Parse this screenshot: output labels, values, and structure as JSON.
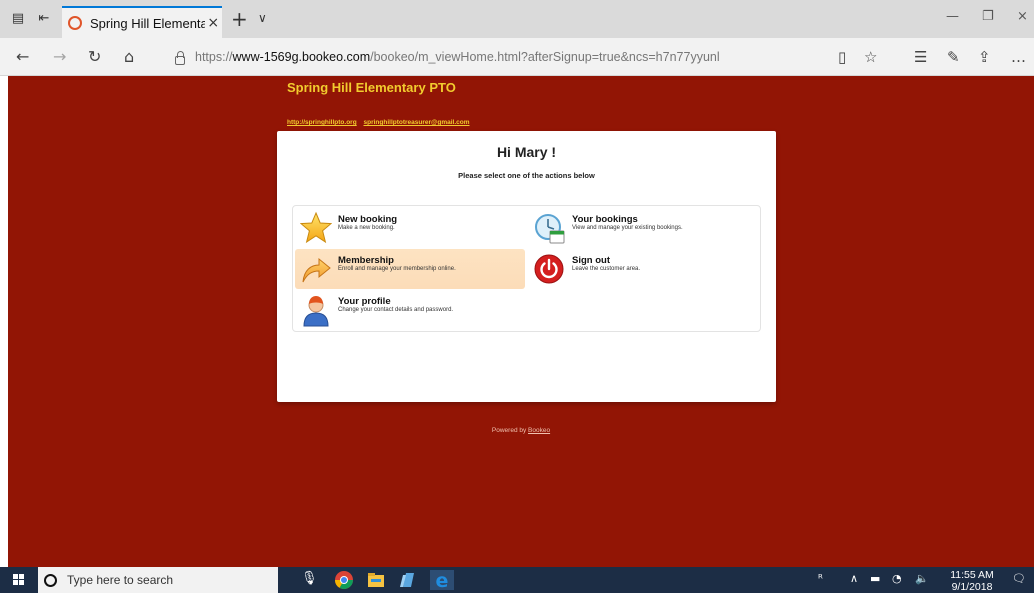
{
  "browser": {
    "tab_title": "Spring Hill Elementary F",
    "tab_close": "×",
    "new_tab": "+",
    "tab_menu": "∨",
    "url_prefix": "https://",
    "url_domain": "www-1569g.bookeo.com",
    "url_path": "/bookeo/m_viewHome.html?afterSignup=true&ncs=h7n77yyunl",
    "window_minimize": "—",
    "window_restore": "❐",
    "window_close": "×"
  },
  "page": {
    "site_title": "Spring Hill Elementary PTO",
    "link_website": "http://springhillpto.org",
    "link_email": "springhillptotreasurer@gmail.com",
    "greeting": "Hi Mary !",
    "subheading": "Please select one of the actions below",
    "actions": [
      {
        "title": "New booking",
        "desc": "Make a new booking.",
        "icon": "star-icon"
      },
      {
        "title": "Your bookings",
        "desc": "View and manage your existing bookings.",
        "icon": "calendar-clock-icon"
      },
      {
        "title": "Membership",
        "desc": "Enroll and manage your membership online.",
        "icon": "arrow-icon"
      },
      {
        "title": "Sign out",
        "desc": "Leave the customer area.",
        "icon": "power-icon"
      },
      {
        "title": "Your profile",
        "desc": "Change your contact details and password.",
        "icon": "person-icon"
      }
    ],
    "powered_prefix": "Powered by",
    "powered_link": "Bookeo"
  },
  "taskbar": {
    "search_placeholder": "Type here to search",
    "time": "11:55 AM",
    "date": "9/1/2018"
  },
  "colors": {
    "page_background": "#921505",
    "title_accent": "#f2cc2e",
    "highlight": "#fde3c2",
    "taskbar": "#1c2d45"
  }
}
